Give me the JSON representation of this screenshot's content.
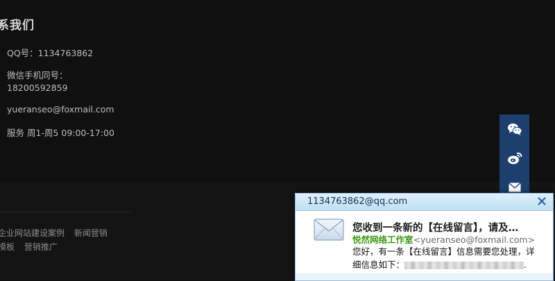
{
  "contact": {
    "title": "系我们",
    "qq": "QQ号：1134763862",
    "wechat_label": "微信手机同号：",
    "phone": "18200592859",
    "email": "yueranseo@foxmail.com",
    "hours": "服务 周1-周5 09:00-17:00"
  },
  "footer_links": {
    "row1": [
      "企业网站建设案例",
      "新闻营销"
    ],
    "row2": [
      "模板",
      "营销推广"
    ]
  },
  "side_bar": {
    "icons": [
      "wechat-icon",
      "weibo-icon",
      "mail-icon"
    ],
    "color": "#1c3f6e"
  },
  "popup": {
    "from": "1134763862@qq.com",
    "subject": "您收到一条新的【在线留言】，请及…",
    "sender_name": "悦然网络工作室",
    "sender_email": "<yueranseo@foxmail.com>",
    "message_line1": "您好，有一条【在线留言】信息需要您处理，详",
    "message_line2_prefix": "细信息如下：",
    "message_line2_suffix": ".",
    "accent_color": "#3c9a12"
  }
}
